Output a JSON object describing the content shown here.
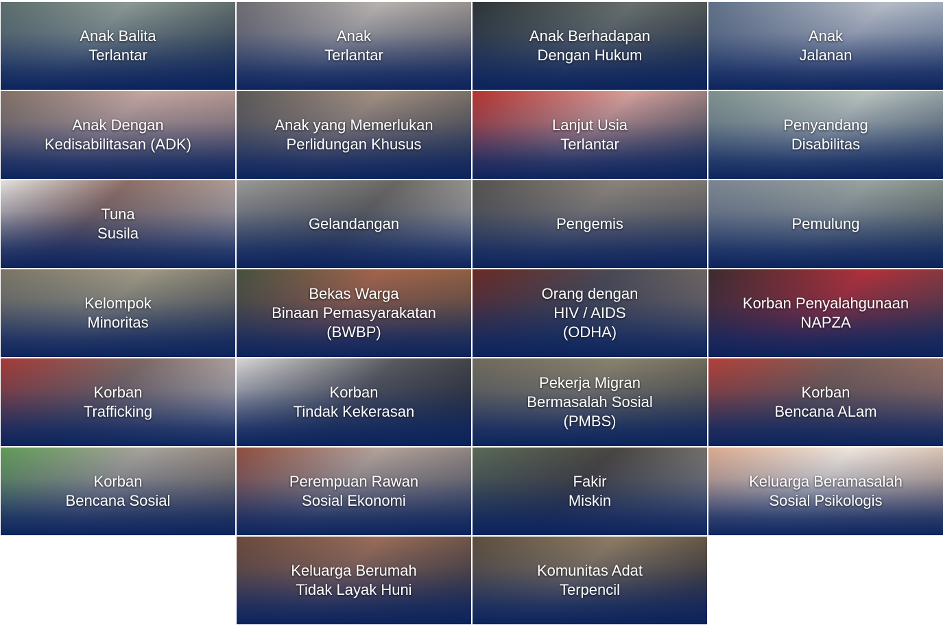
{
  "tiles": [
    {
      "label": "Anak Balita\nTerlantar"
    },
    {
      "label": "Anak\nTerlantar"
    },
    {
      "label": "Anak Berhadapan\nDengan Hukum"
    },
    {
      "label": "Anak\nJalanan"
    },
    {
      "label": "Anak Dengan\nKedisabilitasan (ADK)"
    },
    {
      "label": "Anak yang Memerlukan\nPerlidungan Khusus"
    },
    {
      "label": "Lanjut Usia\nTerlantar"
    },
    {
      "label": "Penyandang\nDisabilitas"
    },
    {
      "label": "Tuna\nSusila"
    },
    {
      "label": "Gelandangan"
    },
    {
      "label": "Pengemis"
    },
    {
      "label": "Pemulung"
    },
    {
      "label": "Kelompok\nMinoritas"
    },
    {
      "label": "Bekas Warga\nBinaan Pemasyarakatan\n(BWBP)"
    },
    {
      "label": "Orang dengan\nHIV / AIDS\n(ODHA)"
    },
    {
      "label": "Korban Penyalahgunaan\nNAPZA"
    },
    {
      "label": "Korban\nTrafficking"
    },
    {
      "label": "Korban\nTindak Kekerasan"
    },
    {
      "label": "Pekerja Migran\nBermasalah Sosial\n(PMBS)"
    },
    {
      "label": "Korban\nBencana ALam"
    },
    {
      "label": "Korban\nBencana Sosial"
    },
    {
      "label": "Perempuan Rawan\nSosial Ekonomi"
    },
    {
      "label": "Fakir\nMiskin"
    },
    {
      "label": "Keluarga Beramasalah\nSosial Psikologis"
    },
    {
      "label": "Keluarga Berumah\nTidak Layak Huni"
    },
    {
      "label": "Komunitas Adat\nTerpencil"
    }
  ]
}
